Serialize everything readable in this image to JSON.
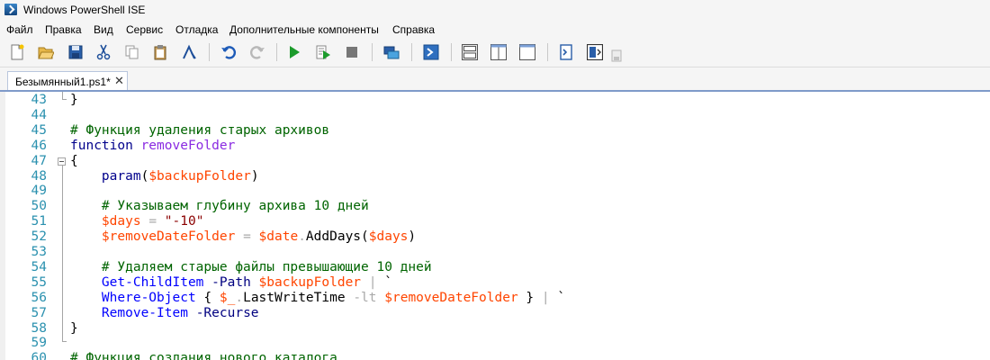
{
  "window": {
    "title": "Windows PowerShell ISE"
  },
  "menu": [
    "Файл",
    "Правка",
    "Вид",
    "Сервис",
    "Отладка",
    "Дополнительные компоненты",
    "Справка"
  ],
  "toolbar": {
    "buttons": [
      "new-script",
      "open",
      "save",
      "cut",
      "copy",
      "paste",
      "clear-console",
      "undo",
      "redo",
      "run-script",
      "run-selection",
      "stop",
      "new-remote-tab",
      "start-powershell",
      "show-script-top",
      "show-script-right",
      "show-script-maximized",
      "show-command-window",
      "show-command-addon"
    ]
  },
  "tabs": [
    {
      "label": "Безымянный1.ps1*",
      "close": "✕"
    }
  ],
  "colors": {
    "linenumber": "#2b91af",
    "comment": "#006400",
    "keyword": "#00008b",
    "function": "#8a2be2",
    "variable": "#ff4500",
    "string": "#8b0000",
    "command": "#0000ff",
    "parameter": "#000080",
    "member": "#000000",
    "operator": "#a9a9a9",
    "plain": "#000000"
  },
  "lines": [
    {
      "n": "43",
      "tokens": [
        {
          "t": "}",
          "c": "plain"
        }
      ]
    },
    {
      "n": "44",
      "tokens": []
    },
    {
      "n": "45",
      "tokens": [
        {
          "t": "# Функция удаления старых архивов",
          "c": "comment"
        }
      ]
    },
    {
      "n": "46",
      "tokens": [
        {
          "t": "function",
          "c": "keyword"
        },
        {
          "t": " ",
          "c": "plain"
        },
        {
          "t": "removeFolder",
          "c": "function"
        }
      ]
    },
    {
      "n": "47",
      "tokens": [
        {
          "t": "{",
          "c": "plain"
        }
      ]
    },
    {
      "n": "48",
      "tokens": [
        {
          "t": "    ",
          "c": "plain"
        },
        {
          "t": "param",
          "c": "keyword"
        },
        {
          "t": "(",
          "c": "plain"
        },
        {
          "t": "$backupFolder",
          "c": "variable"
        },
        {
          "t": ")",
          "c": "plain"
        }
      ]
    },
    {
      "n": "49",
      "tokens": []
    },
    {
      "n": "50",
      "tokens": [
        {
          "t": "    ",
          "c": "plain"
        },
        {
          "t": "# Указываем глубину архива 10 дней",
          "c": "comment"
        }
      ]
    },
    {
      "n": "51",
      "tokens": [
        {
          "t": "    ",
          "c": "plain"
        },
        {
          "t": "$days",
          "c": "variable"
        },
        {
          "t": " ",
          "c": "plain"
        },
        {
          "t": "=",
          "c": "operator"
        },
        {
          "t": " ",
          "c": "plain"
        },
        {
          "t": "\"-10\"",
          "c": "string"
        }
      ]
    },
    {
      "n": "52",
      "tokens": [
        {
          "t": "    ",
          "c": "plain"
        },
        {
          "t": "$removeDateFolder",
          "c": "variable"
        },
        {
          "t": " ",
          "c": "plain"
        },
        {
          "t": "=",
          "c": "operator"
        },
        {
          "t": " ",
          "c": "plain"
        },
        {
          "t": "$date",
          "c": "variable"
        },
        {
          "t": ".",
          "c": "operator"
        },
        {
          "t": "AddDays",
          "c": "member"
        },
        {
          "t": "(",
          "c": "plain"
        },
        {
          "t": "$days",
          "c": "variable"
        },
        {
          "t": ")",
          "c": "plain"
        }
      ]
    },
    {
      "n": "53",
      "tokens": []
    },
    {
      "n": "54",
      "tokens": [
        {
          "t": "    ",
          "c": "plain"
        },
        {
          "t": "# Удаляем старые файлы превышающие 10 дней",
          "c": "comment"
        }
      ]
    },
    {
      "n": "55",
      "tokens": [
        {
          "t": "    ",
          "c": "plain"
        },
        {
          "t": "Get-ChildItem",
          "c": "command"
        },
        {
          "t": " ",
          "c": "plain"
        },
        {
          "t": "-Path",
          "c": "parameter"
        },
        {
          "t": " ",
          "c": "plain"
        },
        {
          "t": "$backupFolder",
          "c": "variable"
        },
        {
          "t": " ",
          "c": "plain"
        },
        {
          "t": "|",
          "c": "operator"
        },
        {
          "t": " `",
          "c": "plain"
        }
      ]
    },
    {
      "n": "56",
      "tokens": [
        {
          "t": "    ",
          "c": "plain"
        },
        {
          "t": "Where-Object",
          "c": "command"
        },
        {
          "t": " { ",
          "c": "plain"
        },
        {
          "t": "$_",
          "c": "variable"
        },
        {
          "t": ".",
          "c": "operator"
        },
        {
          "t": "LastWriteTime",
          "c": "member"
        },
        {
          "t": " ",
          "c": "plain"
        },
        {
          "t": "-lt",
          "c": "operator"
        },
        {
          "t": " ",
          "c": "plain"
        },
        {
          "t": "$removeDateFolder",
          "c": "variable"
        },
        {
          "t": " } ",
          "c": "plain"
        },
        {
          "t": "|",
          "c": "operator"
        },
        {
          "t": " `",
          "c": "plain"
        }
      ]
    },
    {
      "n": "57",
      "tokens": [
        {
          "t": "    ",
          "c": "plain"
        },
        {
          "t": "Remove-Item",
          "c": "command"
        },
        {
          "t": " ",
          "c": "plain"
        },
        {
          "t": "-Recurse",
          "c": "parameter"
        }
      ]
    },
    {
      "n": "58",
      "tokens": [
        {
          "t": "}",
          "c": "plain"
        }
      ]
    },
    {
      "n": "59",
      "tokens": []
    },
    {
      "n": "60",
      "tokens": [
        {
          "t": "# Функция создания нового каталога",
          "c": "comment"
        }
      ]
    }
  ]
}
